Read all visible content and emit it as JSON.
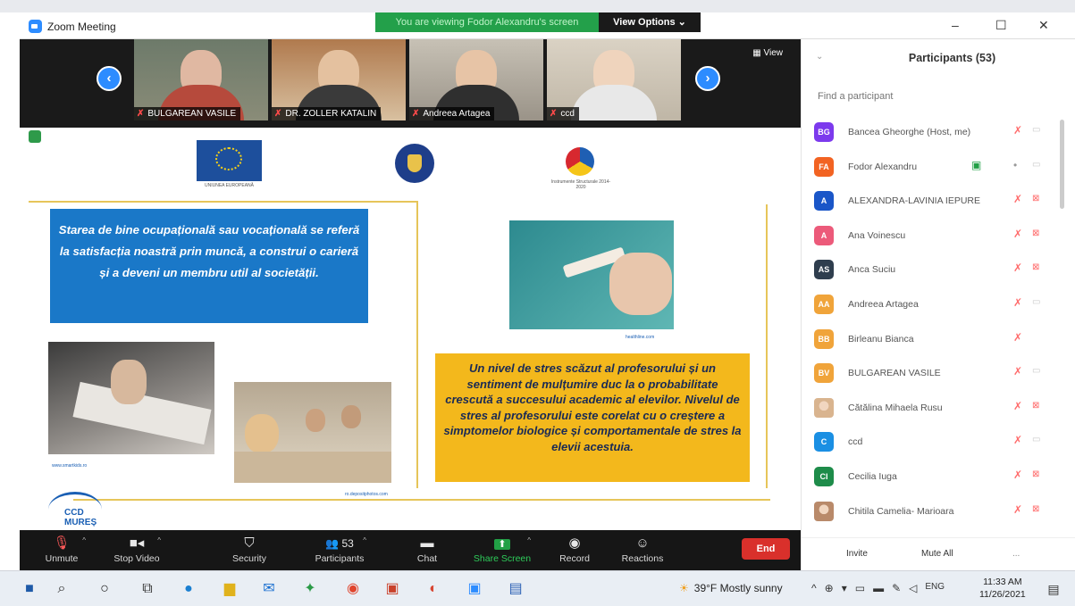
{
  "window": {
    "title": "Zoom Meeting",
    "banner": "You are viewing Fodor Alexandru's screen",
    "view_options": "View Options ⌄",
    "controls": {
      "minimize": "–",
      "maximize": "☐",
      "close": "✕"
    }
  },
  "filmstrip": {
    "prev_icon": "‹",
    "next_icon": "›",
    "view_label": "▦ View",
    "tiles": [
      {
        "name": "BULGAREAN VASILE",
        "muted": true
      },
      {
        "name": "DR. ZOLLER KATALIN",
        "muted": true
      },
      {
        "name": "Andreea Artagea",
        "muted": true
      },
      {
        "name": "ccd",
        "muted": true
      }
    ]
  },
  "slide": {
    "logo_eu_caption": "UNIUNEA EUROPEANĂ",
    "logo_struct_caption": "Instrumente Structurale 2014-2020",
    "text_blue": "Starea de bine ocupațională sau vocațională se referă la satisfacția noastră prin muncă, a construi o carieră și a deveni un membru util al societății.",
    "text_orange": "Un nivel de stres scăzut al profesorului și un sentiment de mulțumire duc la o probabilitate crescută a succesului academic al elevilor. Nivelul de stres al profesorului este corelat cu o creștere a simptomelor biologice și comportamentale de stres la elevii acestuia.",
    "caption_pencil": "healthline.com",
    "caption_writing": "www.smartkids.ro",
    "caption_class": "ro.depositphotos.com",
    "ccd_logo_text": "CCD MUREȘ"
  },
  "toolbar": {
    "buttons": [
      {
        "label": "Unmute",
        "icon": "🎙",
        "caret": true
      },
      {
        "label": "Stop Video",
        "icon": "■◂",
        "caret": true
      },
      {
        "label": "Security",
        "icon": "⛉",
        "caret": false
      },
      {
        "label": "Participants",
        "icon": "👥 53",
        "caret": true
      },
      {
        "label": "Chat",
        "icon": "▬",
        "caret": false
      },
      {
        "label": "Share Screen",
        "icon": "⬆",
        "caret": true
      },
      {
        "label": "Record",
        "icon": "◉",
        "caret": false
      },
      {
        "label": "Reactions",
        "icon": "☺",
        "caret": false
      }
    ],
    "end": "End"
  },
  "panel": {
    "title": "Participants (53)",
    "collapse_icon": "⌄",
    "search_placeholder": "Find a participant",
    "participants": [
      {
        "initials": "BG",
        "name": "Bancea Gheorghe (Host, me)",
        "color": "#7c3aed",
        "video_on": true
      },
      {
        "initials": "FA",
        "name": "Fodor Alexandru",
        "color": "#f26322",
        "sharing": true
      },
      {
        "initials": "A",
        "name": "ALEXANDRA-LAVINIA IEPURE",
        "color": "#1a56c8"
      },
      {
        "initials": "A",
        "name": "Ana Voinescu",
        "color": "#ec5a7a"
      },
      {
        "initials": "AS",
        "name": "Anca Suciu",
        "color": "#2f3e4e"
      },
      {
        "initials": "AA",
        "name": "Andreea Artagea",
        "color": "#f0a43a",
        "video_on": true
      },
      {
        "initials": "BB",
        "name": "Birleanu Bianca",
        "color": "#f0a43a",
        "no_video": true
      },
      {
        "initials": "BV",
        "name": "BULGAREAN VASILE",
        "color": "#f0a43a",
        "video_on": true
      },
      {
        "initials": "",
        "name": "Cătălina Mihaela Rusu",
        "color": "#d9b48f",
        "photo": true
      },
      {
        "initials": "C",
        "name": "ccd",
        "color": "#1a8fe3",
        "video_on": true
      },
      {
        "initials": "CI",
        "name": "Cecilia Iuga",
        "color": "#1e8c4a"
      },
      {
        "initials": "",
        "name": "Chitila Camelia- Marioara",
        "color": "#b98a6a",
        "photo": true
      }
    ],
    "invite": "Invite",
    "mute_all": "Mute All",
    "more": "..."
  },
  "taskbar": {
    "weather": "39°F  Mostly sunny",
    "lang": "ENG",
    "time": "11:33 AM",
    "date": "11/26/2021"
  }
}
